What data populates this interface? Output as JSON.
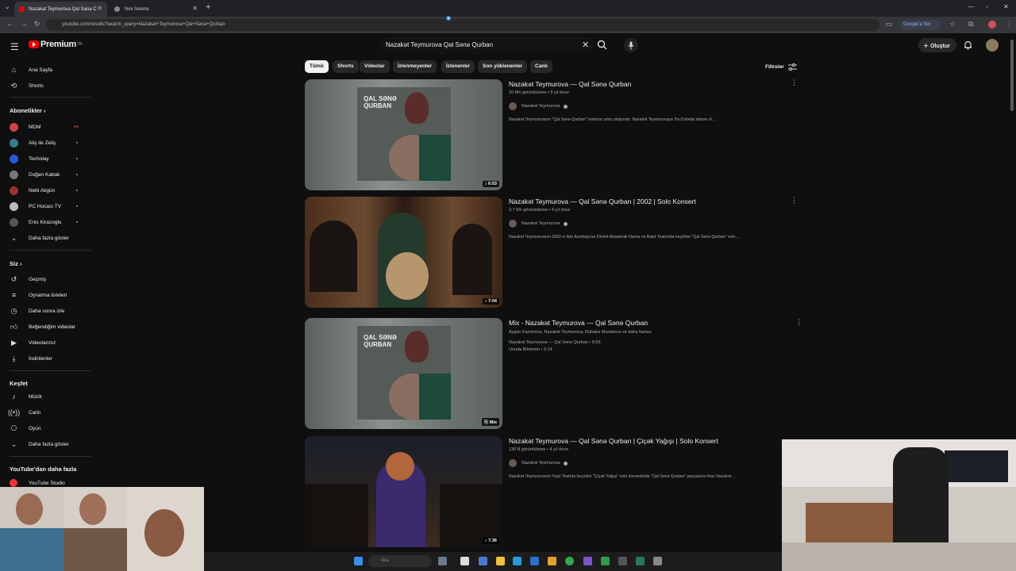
{
  "browser": {
    "tabs": [
      {
        "label": "Nazakat Teymurova Qal Sana C"
      },
      {
        "label": "Yeni Sekme"
      }
    ],
    "url": "youtube.com/results?search_query=Nazakət+Teymurova+Qal+Sənə+Qurban",
    "translate_label": "Google'a Sor"
  },
  "masthead": {
    "logo_text": "Premium",
    "logo_sup": "TR",
    "search_value": "Nazakət Teymurova Qal Sənə Qurban",
    "create_label": "Oluştur"
  },
  "sidebar": {
    "main": [
      {
        "label": "Ana Sayfa",
        "icon": "home-icon"
      },
      {
        "label": "Shorts",
        "icon": "shorts-icon"
      }
    ],
    "subs_header": "Abonelikler",
    "subs": [
      {
        "label": "MDM",
        "live": true,
        "color": "#c44"
      },
      {
        "label": "Aliş ile Zeliş",
        "color": "#3a7a8a"
      },
      {
        "label": "Techolay",
        "color": "#2a5bd7"
      },
      {
        "label": "Doğan Kabak",
        "color": "#777"
      },
      {
        "label": "Nebi Akgün",
        "color": "#933"
      },
      {
        "label": "PC Hocası TV",
        "color": "#bbb"
      },
      {
        "label": "Enis Kirazoglu",
        "color": "#555"
      }
    ],
    "subs_more": "Daha fazla göster",
    "you_header": "Siz",
    "you": [
      {
        "label": "Geçmiş",
        "icon": "history-icon"
      },
      {
        "label": "Oynatma listeleri",
        "icon": "playlist-icon"
      },
      {
        "label": "Daha sonra izle",
        "icon": "watch-later-icon"
      },
      {
        "label": "Beğendiğim videolar",
        "icon": "like-icon"
      },
      {
        "label": "Videolarınız",
        "icon": "your-videos-icon"
      },
      {
        "label": "İndirilenler",
        "icon": "download-icon"
      }
    ],
    "explore_header": "Keşfet",
    "explore": [
      {
        "label": "Müzik",
        "icon": "music-icon"
      },
      {
        "label": "Canlı",
        "icon": "live-icon"
      },
      {
        "label": "Oyun",
        "icon": "gaming-icon"
      }
    ],
    "explore_more": "Daha fazla göster",
    "more_header": "YouTube'dan daha fazla",
    "more": [
      {
        "label": "YouTube Studio"
      }
    ]
  },
  "chips": [
    "Tümü",
    "Shorts",
    "Videolar",
    "İzlenmeyenler",
    "İzlenenler",
    "Son yüklenenler",
    "Canlı"
  ],
  "filters_label": "Filtreler",
  "results": [
    {
      "title": "Nazakət Teymurova — Qal Sənə Qurban",
      "meta": "10 Mn görüntüleme • 5 yıl önce",
      "channel": "Nazakət Teymurova",
      "desc": "Nazakət Teymurovanın \"Qal Sənə Qurban\" mahnısı artıq onlayndır. Nazakət Teymurovaya YouTubeda abune ol ...",
      "duration": "6:53",
      "thumb_text": "QAL SƏNƏ QURBAN"
    },
    {
      "title": "Nazakət Teymurova — Qal Sənə Qurban | 2002 | Solo Konsert",
      "meta": "2,7 Mn görüntüleme • 4 yıl önce",
      "channel": "Nazakət Teymurova",
      "desc": "Nazakət Teymurovanın 2002-ci ildə Azərbaycan Dövlət Akademik Opera və Balet Teatrında keçirilən \"Qal Sənə Qurban\" solo ...",
      "duration": "7:04"
    },
    {
      "title": "Mix - Nazakət Teymurova — Qal Sənə Qurban",
      "meta": "Aygün Kazımova, Nazakət Teymurova, Rübabə Muradova ve daha fazlası",
      "line1": "Nazakət Teymurova — Qal Sənə Qurban • 6:53",
      "line2": "Unuda Bilmirəm • 5:14",
      "duration": "Mix",
      "thumb_text": "QAL SƏNƏ QURBAN"
    },
    {
      "title": "Nazakət Teymurova — Qal Sənə Qurban | Çiçək Yağışı | Solo Konsert",
      "meta": "130 B görüntüleme • 4 yıl önce",
      "channel": "Nazakət Teymurova",
      "desc": "Nazakət Teymurovanın Yaşıl Teatrda keçirilən \"Çiçək Yağışı\" solo konsertində \"Qal Sənə Qurban\" parçasının ifası Nazakət ...",
      "duration": "7:36"
    }
  ],
  "taskbar": {
    "search_placeholder": "Ara"
  },
  "colors": {
    "accent": "#ff0000",
    "background": "#0f0f0f",
    "link": "#3ea6ff"
  }
}
